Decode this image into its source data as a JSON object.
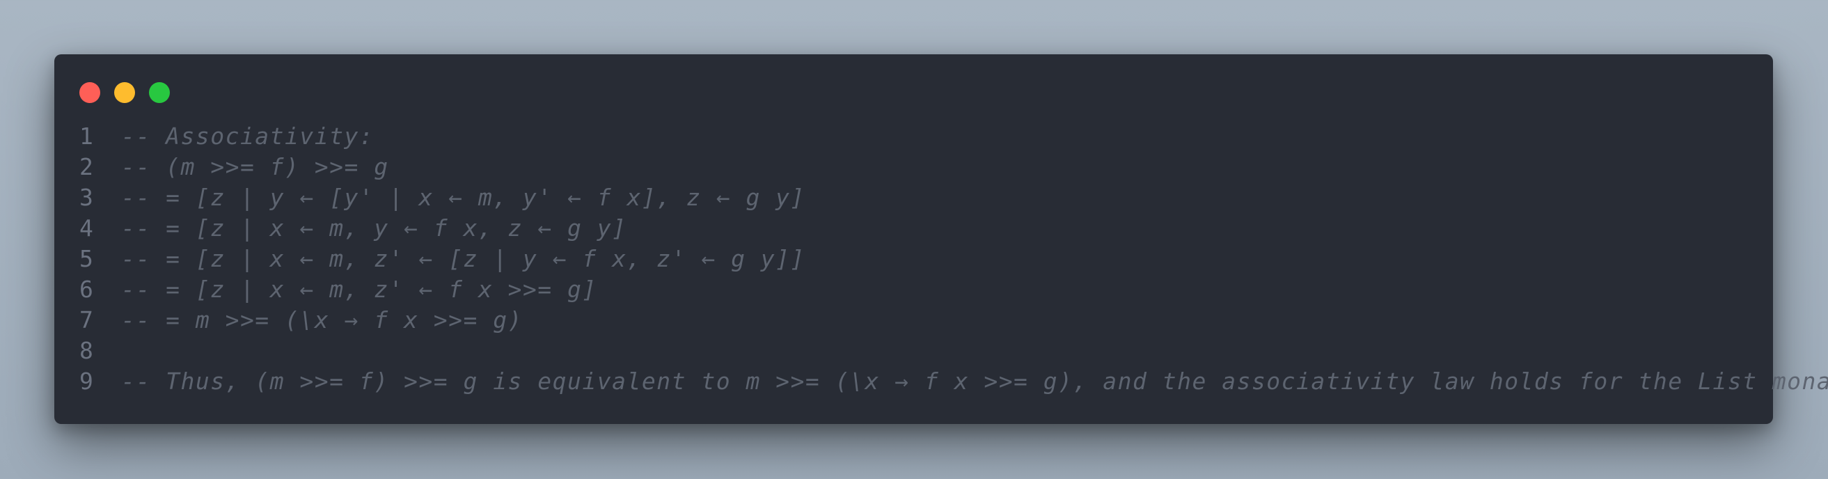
{
  "window": {
    "controls": [
      "close",
      "minimize",
      "maximize"
    ],
    "colors": {
      "close": "#ff5f57",
      "minimize": "#febc2e",
      "maximize": "#28c840"
    }
  },
  "code": {
    "lines": [
      {
        "number": "1",
        "text": "-- Associativity:"
      },
      {
        "number": "2",
        "text": "-- (m >>= f) >>= g"
      },
      {
        "number": "3",
        "text": "-- = [z | y ← [y' | x ← m, y' ← f x], z ← g y]"
      },
      {
        "number": "4",
        "text": "-- = [z | x ← m, y ← f x, z ← g y]"
      },
      {
        "number": "5",
        "text": "-- = [z | x ← m, z' ← [z | y ← f x, z' ← g y]]"
      },
      {
        "number": "6",
        "text": "-- = [z | x ← m, z' ← f x >>= g]"
      },
      {
        "number": "7",
        "text": "-- = m >>= (\\x → f x >>= g)"
      },
      {
        "number": "8",
        "text": ""
      },
      {
        "number": "9",
        "text": "-- Thus, (m >>= f) >>= g is equivalent to m >>= (\\x → f x >>= g), and the associativity law holds for the List monad."
      }
    ]
  }
}
